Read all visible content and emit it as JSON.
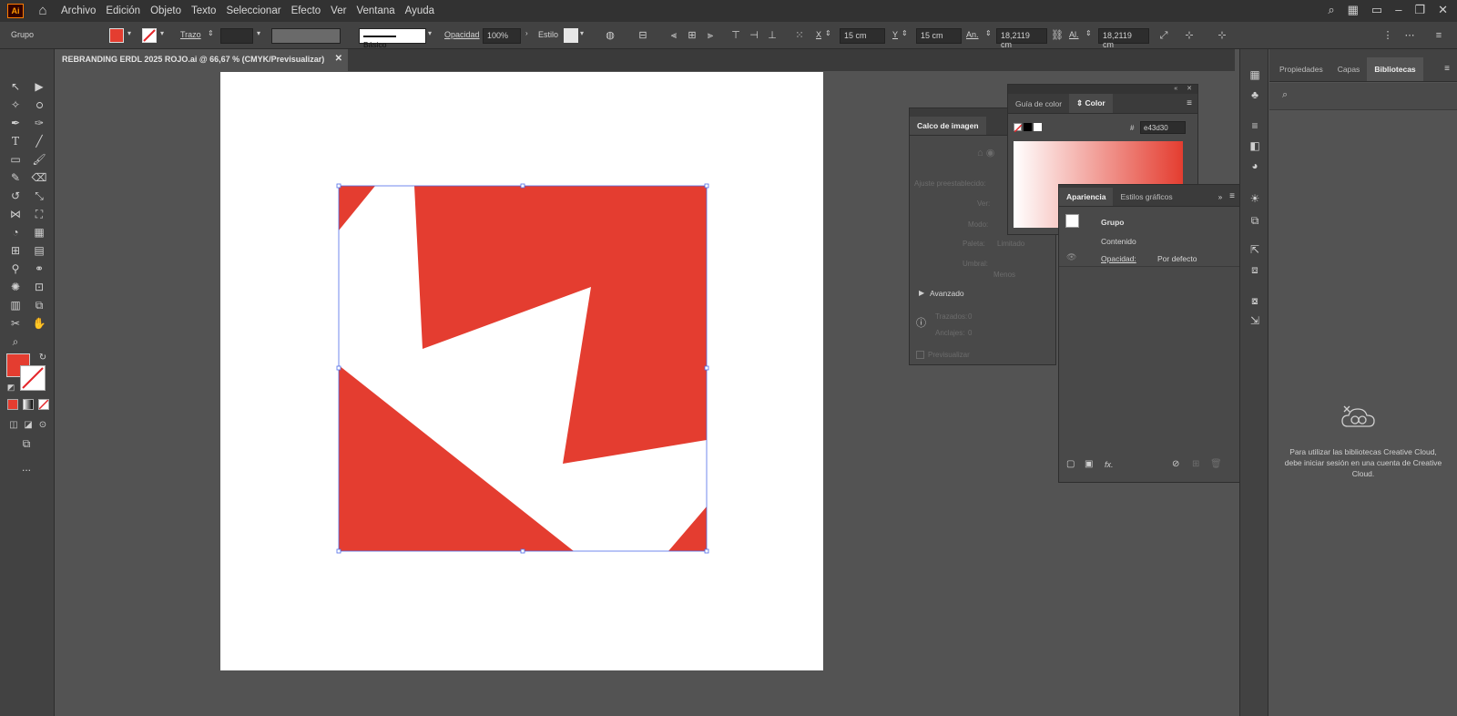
{
  "app": {
    "logo": "Ai",
    "menu": [
      "Archivo",
      "Edición",
      "Objeto",
      "Texto",
      "Seleccionar",
      "Efecto",
      "Ver",
      "Ventana",
      "Ayuda"
    ]
  },
  "control_bar": {
    "selection_type": "Grupo",
    "fill_color": "#e43d30",
    "stroke_label": "Trazo",
    "stroke_style": "Básico",
    "opacity_label": "Opacidad",
    "opacity_value": "100%",
    "style_label": "Estilo",
    "x_label": "X",
    "x_value": "15 cm",
    "y_label": "Y",
    "y_value": "15 cm",
    "width_label": "An.",
    "width_value": "18,2119 cm",
    "height_label": "Al.",
    "height_value": "18,2119 cm"
  },
  "document": {
    "tab_title": "REBRANDING ERDL 2025 ROJO.ai @ 66,67 % (CMYK/Previsualizar)",
    "artwork_color": "#e43d30"
  },
  "tools": {
    "fill_color": "#e43d30",
    "more": "..."
  },
  "image_trace_panel": {
    "title": "Calco de imagen",
    "preset_label": "Ajuste preestablecido:",
    "view_label": "Ver:",
    "mode_label": "Modo:",
    "palette_label": "Paleta:",
    "palette_value": "Limitado",
    "threshold_label": "Umbral:",
    "threshold_less": "Menos",
    "advanced_label": "Avanzado",
    "paths_label": "Trazados:",
    "paths_value": "0",
    "anchors_label": "Anclajes:",
    "anchors_value": "0",
    "preview_label": "Previsualizar"
  },
  "color_panel": {
    "tab_guide": "Guía de color",
    "tab_color": "Color",
    "hex_symbol": "#",
    "hex_value": "e43d30"
  },
  "appearance_panel": {
    "tab_appearance": "Apariencia",
    "tab_graphic_styles": "Estilos gráficos",
    "group_label": "Grupo",
    "contents_label": "Contenido",
    "opacity_label": "Opacidad:",
    "opacity_value": "Por defecto",
    "fx_label": "fx."
  },
  "libraries_panel": {
    "tab_properties": "Propiedades",
    "tab_layers": "Capas",
    "tab_libraries": "Bibliotecas",
    "message": "Para utilizar las bibliotecas Creative Cloud, debe iniciar sesión en una cuenta de Creative Cloud."
  }
}
